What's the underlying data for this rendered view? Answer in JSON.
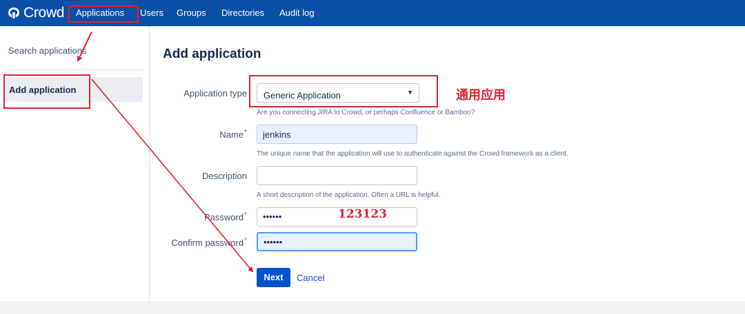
{
  "app": {
    "brand": "Crowd",
    "brand_color": "#0b50a8",
    "logo_icon": "crowd-logo-icon"
  },
  "nav": {
    "items": [
      {
        "label": "Applications",
        "active": true
      },
      {
        "label": "Users"
      },
      {
        "label": "Groups"
      },
      {
        "label": "Directories"
      },
      {
        "label": "Audit log"
      }
    ]
  },
  "sidebar": {
    "search_label": "Search applications",
    "active_label": "Add application"
  },
  "form": {
    "title": "Add application",
    "application_type": {
      "label": "Application type",
      "value": "Generic Application",
      "help": "Are you connecting JIRA to Crowd, or perhaps Confluence or Bamboo?"
    },
    "name": {
      "label": "Name",
      "value": "jenkins",
      "required": "*",
      "help": "The unique name that the application will use to authenticate against the Crowd framework as a client."
    },
    "description": {
      "label": "Description",
      "value": "",
      "help": "A short description of the application. Often a URL is helpful."
    },
    "password": {
      "label": "Password",
      "value": "••••••",
      "required": "*"
    },
    "confirm_password": {
      "label": "Confirm password",
      "value": "••••••",
      "required": "*"
    },
    "next_label": "Next",
    "cancel_label": "Cancel"
  },
  "annotations": {
    "color": "#e0202f",
    "generic_app_note": "通用应用",
    "password_note": "123123"
  }
}
